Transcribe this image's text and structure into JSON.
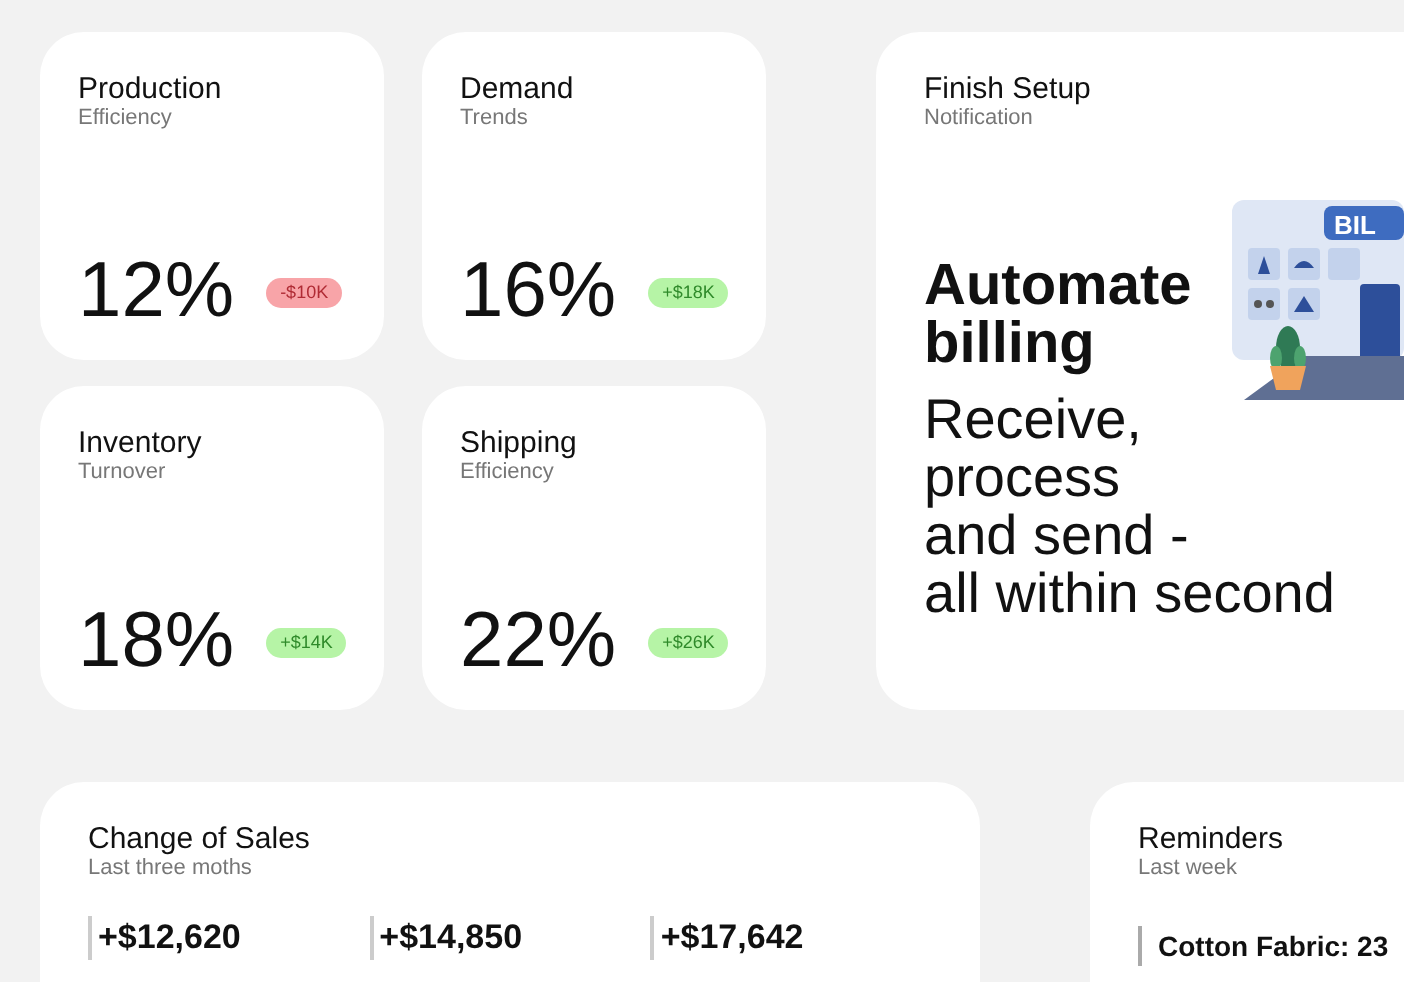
{
  "metric_cards": [
    {
      "title": "Production",
      "subtitle": "Efficiency",
      "value": "12%",
      "change": "-$10K",
      "kind": "negative"
    },
    {
      "title": "Demand",
      "subtitle": "Trends",
      "value": "16%",
      "change": "+$18K",
      "kind": "positive"
    },
    {
      "title": "Inventory",
      "subtitle": "Turnover",
      "value": "18%",
      "change": "+$14K",
      "kind": "positive"
    },
    {
      "title": "Shipping",
      "subtitle": "Efficiency",
      "value": "22%",
      "change": "+$26K",
      "kind": "positive"
    }
  ],
  "setup_card": {
    "title": "Finish Setup",
    "subtitle": "Notification",
    "headline": "Automate billing",
    "body": [
      "Receive,",
      "process",
      "and send -",
      "all within second"
    ],
    "illustration_label": "BIL"
  },
  "sales_card": {
    "title": "Change of Sales",
    "subtitle": "Last three moths",
    "values": [
      "+$12,620",
      "+$14,850",
      "+$17,642"
    ]
  },
  "reminders_card": {
    "title": "Reminders",
    "subtitle": "Last week",
    "items": [
      "Cotton Fabric: 23"
    ]
  }
}
